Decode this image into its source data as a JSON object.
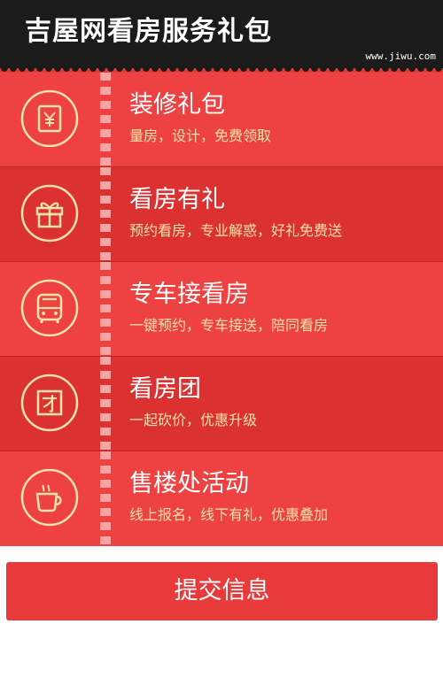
{
  "header": {
    "title": "吉屋网看房服务礼包",
    "site": "www.jiwu.com"
  },
  "items": [
    {
      "name": "装修礼包",
      "desc": "量房，设计，免费领取",
      "icon": "yen-tag-icon"
    },
    {
      "name": "看房有礼",
      "desc": "预约看房，专业解惑，好礼免费送",
      "icon": "gift-icon"
    },
    {
      "name": "专车接看房",
      "desc": "一键预约，专车接送，陪同看房",
      "icon": "bus-icon"
    },
    {
      "name": "看房团",
      "desc": "一起砍价，优惠升级",
      "icon": "group-tuan-icon"
    },
    {
      "name": "售楼处活动",
      "desc": "线上报名，线下有礼，优惠叠加",
      "icon": "coffee-cup-icon"
    }
  ],
  "submit": {
    "label": "提交信息"
  },
  "colors": {
    "header_bg": "#1b1b1b",
    "row_light": "#ee4242",
    "row_dark": "#dc3131",
    "accent_gold": "#f7e3a5",
    "button_bg": "#e83a3a"
  }
}
